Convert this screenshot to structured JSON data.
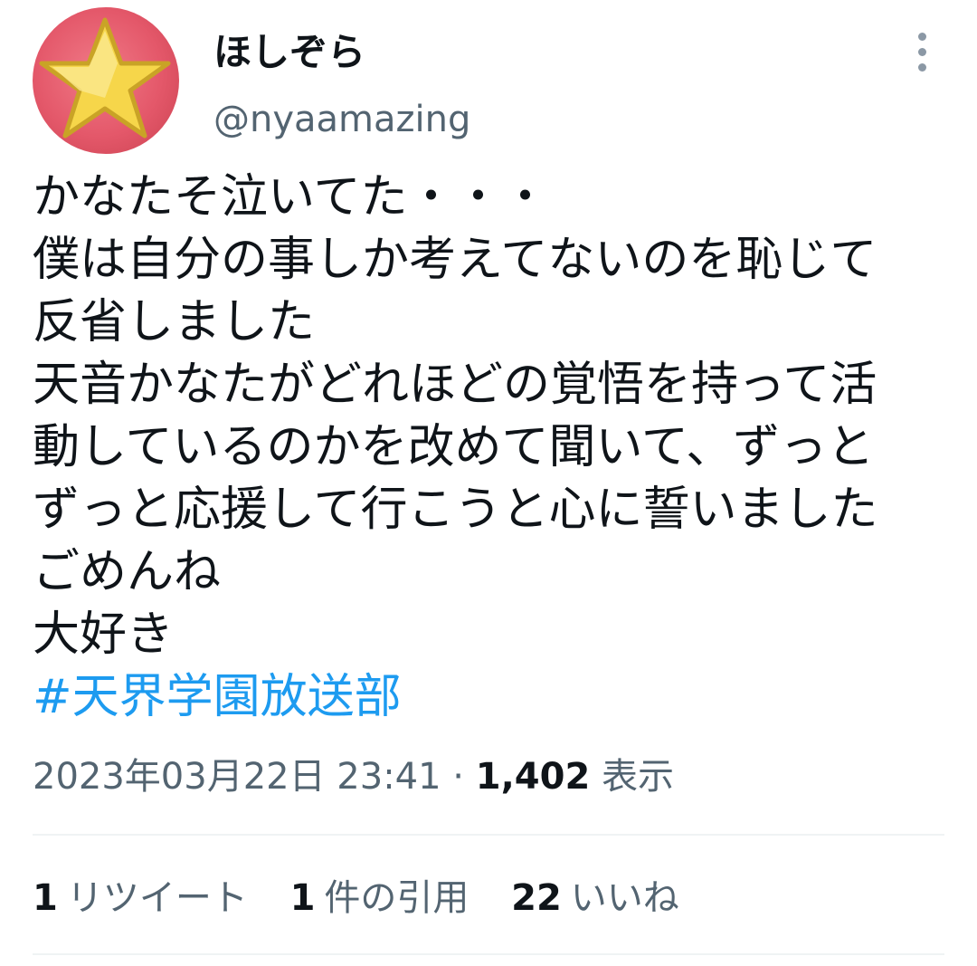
{
  "author": {
    "display_name": "ほしぞら",
    "handle": "@nyaamazing",
    "avatar_icon": "star-icon",
    "avatar_bg_color": "#e4586a",
    "avatar_star_color": "#f6d64a"
  },
  "tweet": {
    "lines": [
      "かなたそ泣いてた・・・",
      "僕は自分の事しか考えてないのを恥じて",
      "反省しました",
      "天音かなたがどれほどの覚悟を持って活",
      "動しているのかを改めて聞いて、ずっと",
      "ずっと応援して行こうと心に誓いました",
      "ごめんね",
      "大好き"
    ],
    "hashtag": "#天界学園放送部",
    "hashtag_color": "#1d9bf0"
  },
  "meta": {
    "timestamp": "2023年03月22日 23:41",
    "separator": " · ",
    "views_count": "1,402",
    "views_label": "表示"
  },
  "stats": {
    "retweets_count": "1",
    "retweets_label": "リツイート",
    "quotes_count": "1",
    "quotes_label": "件の引用",
    "likes_count": "22",
    "likes_label": "いいね"
  },
  "more_icon": "more-vertical-icon"
}
